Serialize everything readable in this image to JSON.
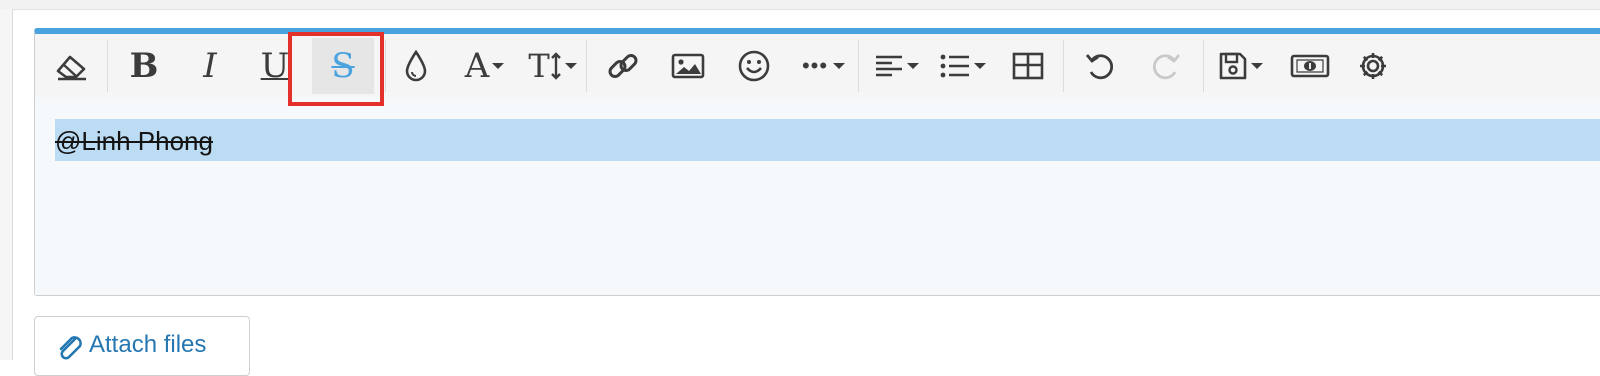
{
  "editor": {
    "accent_color": "#4aa3df",
    "content": {
      "mention_text": "@Linh Phong"
    },
    "toolbar": {
      "buttons": [
        {
          "name": "remove-formatting",
          "icon": "eraser-icon"
        },
        {
          "name": "bold",
          "label": "B",
          "icon": "bold-icon"
        },
        {
          "name": "italic",
          "label": "I",
          "icon": "italic-icon"
        },
        {
          "name": "underline",
          "label": "U",
          "icon": "underline-icon"
        },
        {
          "name": "strikethrough",
          "label": "S",
          "icon": "strikethrough-icon",
          "active": true
        },
        {
          "name": "text-color",
          "icon": "droplet-icon"
        },
        {
          "name": "font-family",
          "label": "A",
          "icon": "font-icon"
        },
        {
          "name": "font-size",
          "label": "T",
          "icon": "text-size-icon"
        },
        {
          "name": "link",
          "icon": "link-icon"
        },
        {
          "name": "image",
          "icon": "image-icon"
        },
        {
          "name": "emoji",
          "icon": "smiley-icon"
        },
        {
          "name": "more",
          "label": "•••",
          "icon": "more-icon"
        },
        {
          "name": "align",
          "icon": "align-left-icon"
        },
        {
          "name": "list",
          "icon": "list-icon"
        },
        {
          "name": "table",
          "icon": "table-icon"
        },
        {
          "name": "undo",
          "icon": "undo-icon"
        },
        {
          "name": "redo",
          "icon": "redo-icon",
          "disabled": true
        },
        {
          "name": "drafts",
          "icon": "save-icon"
        },
        {
          "name": "insert-money",
          "icon": "money-icon"
        },
        {
          "name": "settings",
          "icon": "gear-icon"
        }
      ]
    }
  },
  "highlight_color": "#e3302a",
  "attach": {
    "label": "Attach files",
    "icon": "paperclip-icon"
  }
}
